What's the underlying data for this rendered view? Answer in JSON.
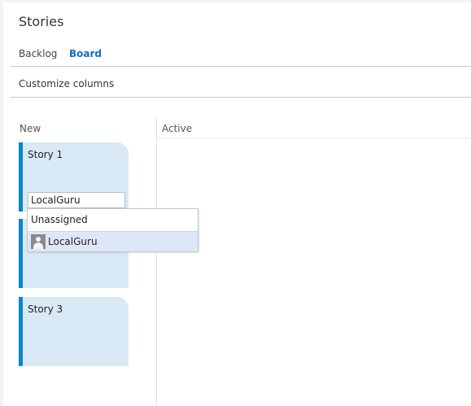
{
  "header": {
    "title": "Stories"
  },
  "tabs": [
    {
      "label": "Backlog",
      "active": false
    },
    {
      "label": "Board",
      "active": true
    }
  ],
  "toolbar": {
    "customize_label": "Customize columns"
  },
  "columns": [
    {
      "label": "New"
    },
    {
      "label": "Active"
    }
  ],
  "cards": [
    {
      "title": "Story 1"
    },
    {
      "title": ""
    },
    {
      "title": "Story 3"
    }
  ],
  "assign": {
    "input_value": "LocalGuru",
    "options": [
      {
        "label": "Unassigned",
        "icon": ""
      },
      {
        "label": "LocalGuru",
        "icon": "user-avatar-icon",
        "highlighted": true
      }
    ]
  },
  "colors": {
    "accent": "#106ebe",
    "card_bar": "#0a86c8",
    "card_bg": "#d9e9f6",
    "highlight": "#dde7f7"
  }
}
